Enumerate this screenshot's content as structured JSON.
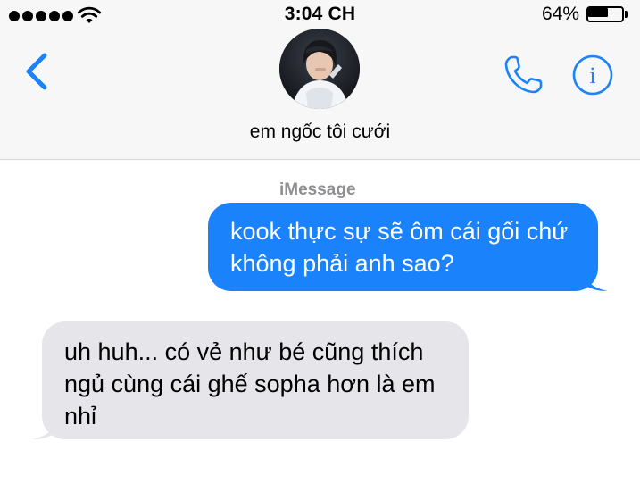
{
  "status_bar": {
    "time": "3:04 CH",
    "battery_percent": "64%",
    "battery_level": 0.64,
    "signal_bars": 5,
    "icons": [
      "signal-dots-icon",
      "wifi-icon",
      "battery-icon"
    ]
  },
  "nav": {
    "back_icon": "chevron-left-icon",
    "contact_name": "em ngốc tôi cưới",
    "phone_icon": "phone-icon",
    "info_icon": "info-icon"
  },
  "conversation": {
    "service_label": "iMessage",
    "messages": [
      {
        "direction": "outgoing",
        "text": "kook thực sự sẽ ôm cái gối chứ không phải anh sao?"
      },
      {
        "direction": "incoming",
        "text": "uh huh... có vẻ như bé cũng thích ngủ cùng cái ghế sopha hơn là em nhỉ"
      }
    ]
  },
  "colors": {
    "accent": "#1a82fb",
    "outgoing_bubble": "#1a82fb",
    "incoming_bubble": "#e5e5ea",
    "header_background": "#f7f7f7",
    "secondary_text": "#8e8e93"
  }
}
